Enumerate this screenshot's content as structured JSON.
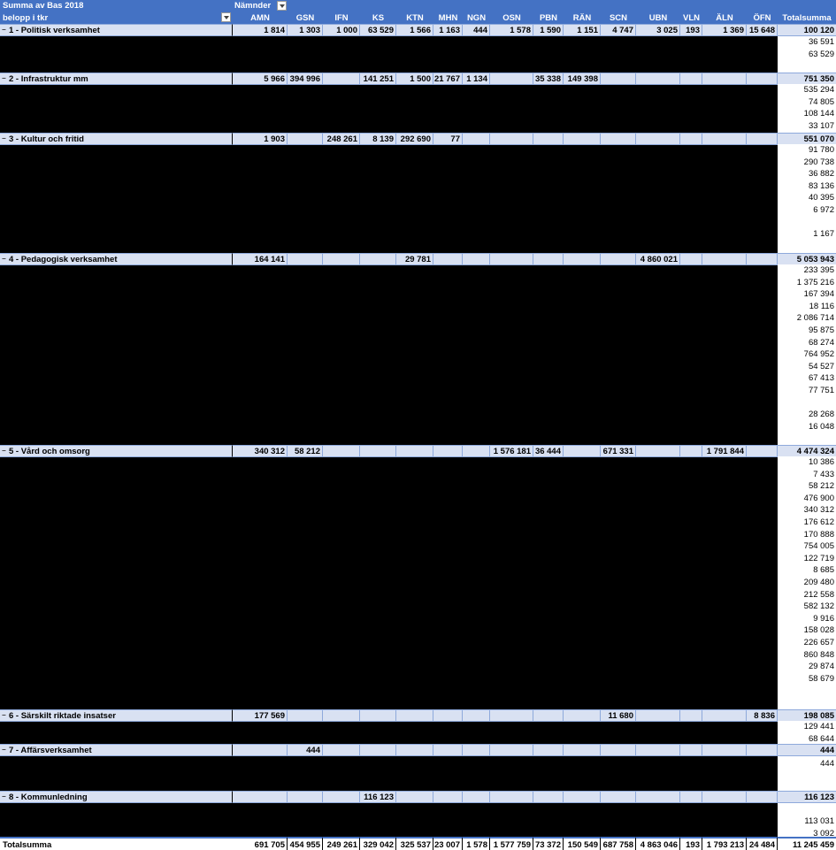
{
  "pivot": {
    "title": "Summa av Bas 2018",
    "column_field": "Nämnder",
    "row_field": "belopp i tkr",
    "total_header": "Totalsumma",
    "columns": [
      "AMN",
      "GSN",
      "IFN",
      "KS",
      "KTN",
      "MHN",
      "NGN",
      "OSN",
      "PBN",
      "RÄN",
      "SCN",
      "UBN",
      "VLN",
      "ÄLN",
      "ÖFN"
    ]
  },
  "categories": [
    {
      "label": "1 - Politisk verksamhet",
      "toggle": "−",
      "values": [
        "1 814",
        "1 303",
        "1 000",
        "63 529",
        "1 566",
        "1 163",
        "444",
        "1 578",
        "1 590",
        "1 151",
        "4 747",
        "3 025",
        "193",
        "1 369",
        "15 648"
      ],
      "total": "100 120",
      "sub_totals": [
        "36 591",
        "63 529"
      ]
    },
    {
      "label": "2 - Infrastruktur mm",
      "toggle": "−",
      "values": [
        "5 966",
        "394 996",
        "",
        "141 251",
        "1 500",
        "21 767",
        "1 134",
        "",
        "35 338",
        "149 398",
        "",
        "",
        "",
        "",
        ""
      ],
      "total": "751 350",
      "sub_totals": [
        "535 294",
        "74 805",
        "108 144",
        "33 107"
      ]
    },
    {
      "label": "3 - Kultur och fritid",
      "toggle": "−",
      "values": [
        "1 903",
        "",
        "248 261",
        "8 139",
        "292 690",
        "77",
        "",
        "",
        "",
        "",
        "",
        "",
        "",
        "",
        ""
      ],
      "total": "551 070",
      "sub_totals": [
        "91 780",
        "290 738",
        "36 882",
        "83 136",
        "40 395",
        "6 972",
        "",
        "1 167"
      ]
    },
    {
      "label": "4 - Pedagogisk verksamhet",
      "toggle": "−",
      "values": [
        "164 141",
        "",
        "",
        "",
        "29 781",
        "",
        "",
        "",
        "",
        "",
        "",
        "4 860 021",
        "",
        "",
        ""
      ],
      "total": "5 053 943",
      "sub_totals": [
        "233 395",
        "1 375 216",
        "167 394",
        "18 116",
        "2 086 714",
        "95 875",
        "68 274",
        "764 952",
        "54 527",
        "67 413",
        "77 751",
        "",
        "28 268",
        "16 048"
      ]
    },
    {
      "label": "5 - Vård och omsorg",
      "toggle": "−",
      "values": [
        "340 312",
        "58 212",
        "",
        "",
        "",
        "",
        "",
        "1 576 181",
        "36 444",
        "",
        "671 331",
        "",
        "",
        "1 791 844",
        ""
      ],
      "total": "4 474 324",
      "sub_totals": [
        "10 386",
        "7 433",
        "58 212",
        "476 900",
        "340 312",
        "176 612",
        "170 888",
        "754 005",
        "122 719",
        "8 685",
        "209 480",
        "212 558",
        "582 132",
        "9 916",
        "158 028",
        "226 657",
        "860 848",
        "29 874",
        "58 679"
      ]
    },
    {
      "label": "6 - Särskilt riktade insatser",
      "toggle": "−",
      "values": [
        "177 569",
        "",
        "",
        "",
        "",
        "",
        "",
        "",
        "",
        "",
        "11 680",
        "",
        "",
        "",
        "8 836"
      ],
      "total": "198 085",
      "sub_totals": [
        "129 441",
        "68 644"
      ]
    },
    {
      "label": "7 - Affärsverksamhet",
      "toggle": "−",
      "values": [
        "",
        "444",
        "",
        "",
        "",
        "",
        "",
        "",
        "",
        "",
        "",
        "",
        "",
        "",
        ""
      ],
      "total": "444",
      "sub_totals": [
        "444"
      ]
    },
    {
      "label": "8 - Kommunledning",
      "toggle": "−",
      "values": [
        "",
        "",
        "",
        "116 123",
        "",
        "",
        "",
        "",
        "",
        "",
        "",
        "",
        "",
        "",
        ""
      ],
      "total": "116 123",
      "sub_totals": [
        "",
        "113 031",
        "3 092"
      ]
    }
  ],
  "grand_total": {
    "label": "Totalsumma",
    "values": [
      "691 705",
      "454 955",
      "249 261",
      "329 042",
      "325 537",
      "23 007",
      "1 578",
      "1 577 759",
      "73 372",
      "150 549",
      "687 758",
      "4 863 046",
      "193",
      "1 793 213",
      "24 484"
    ],
    "total": "11 245 459"
  }
}
